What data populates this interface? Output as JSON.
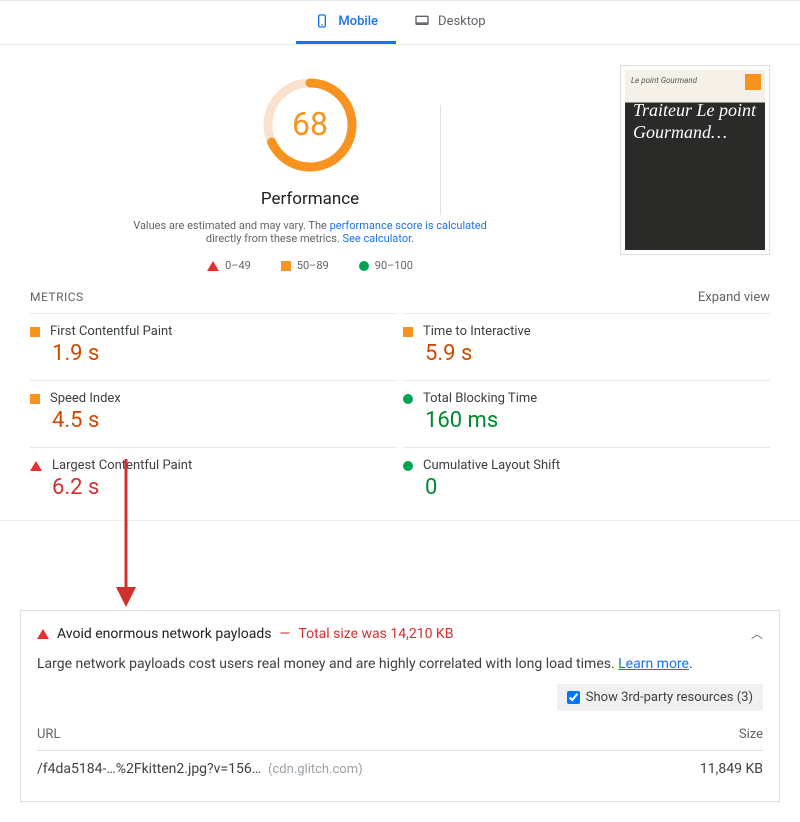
{
  "tabs": {
    "mobile": "Mobile",
    "desktop": "Desktop"
  },
  "gauge": {
    "score": "68",
    "label": "Performance"
  },
  "description": {
    "prefix": "Values are estimated and may vary. The ",
    "link1": "performance score is calculated",
    "mid": "directly from these metrics. ",
    "link2": "See calculator."
  },
  "legend": {
    "r1": "0–49",
    "r2": "50–89",
    "r3": "90–100"
  },
  "sections": {
    "metrics": "METRICS",
    "expand": "Expand view"
  },
  "metrics": {
    "fcp_label": "First Contentful Paint",
    "fcp_value": "1.9 s",
    "si_label": "Speed Index",
    "si_value": "4.5 s",
    "lcp_label": "Largest Contentful Paint",
    "lcp_value": "6.2 s",
    "tti_label": "Time to Interactive",
    "tti_value": "5.9 s",
    "tbt_label": "Total Blocking Time",
    "tbt_value": "160 ms",
    "cls_label": "Cumulative Layout Shift",
    "cls_value": "0"
  },
  "preview": {
    "logo": "Le point Gourmand",
    "title": "Traiteur Le point Gourmand…"
  },
  "audit": {
    "title": "Avoid enormous network payloads",
    "dash": "—",
    "warn": "Total size was 14,210 KB",
    "desc": "Large network payloads cost users real money and are highly correlated with long load times. ",
    "learn": "Learn more",
    "learn_suffix": ".",
    "third_party": "Show 3rd-party resources (3)",
    "cols": {
      "url": "URL",
      "size": "Size"
    },
    "row": {
      "path": "/f4da5184-…%2Fkitten2.jpg?v=156…",
      "host": "(cdn.glitch.com)",
      "size": "11,849 KB"
    }
  }
}
